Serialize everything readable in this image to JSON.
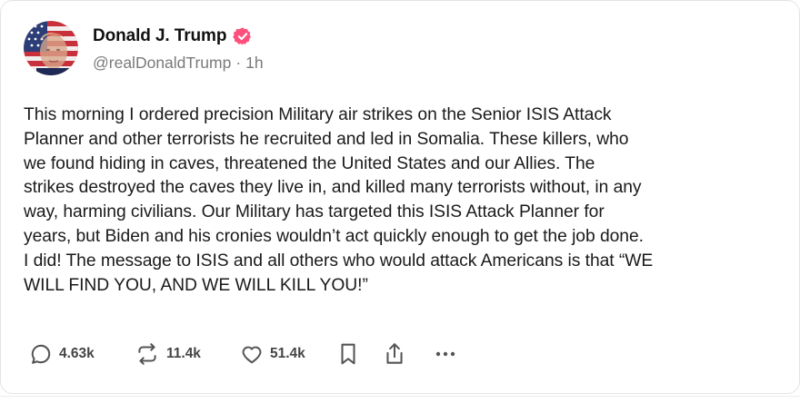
{
  "post": {
    "author": {
      "display_name": "Donald J. Trump",
      "handle": "@realDonaldTrump",
      "verified": true,
      "verified_icon": "verified-badge-icon",
      "avatar_icon": "avatar-flag-portrait"
    },
    "meta_separator": "·",
    "time_ago": "1h",
    "lines": [
      "This morning I ordered precision Military air strikes on the Senior ISIS Attack",
      "Planner and other terrorists he recruited and led in Somalia. These killers, who",
      "we found hiding in caves, threatened the United States and our Allies. The",
      "strikes destroyed the caves they live in, and killed many terrorists without, in any",
      "way, harming civilians. Our Military has targeted this ISIS Attack Planner for",
      "years, but Biden and his cronies wouldn’t act quickly enough to get the job done.",
      "I did! The message to ISIS and all others who would attack Americans is that “WE",
      "WILL FIND YOU, AND WE WILL KILL YOU!”"
    ],
    "actions": {
      "reply": {
        "icon": "reply-bubble-icon",
        "count": "4.63k"
      },
      "retruth": {
        "icon": "repost-arrows-icon",
        "count": "11.4k"
      },
      "like": {
        "icon": "heart-icon",
        "count": "51.4k"
      },
      "bookmark": {
        "icon": "bookmark-icon"
      },
      "share": {
        "icon": "share-upload-icon"
      },
      "more": {
        "icon": "more-dots-icon"
      }
    }
  },
  "colors": {
    "badge": "#ff4f7b",
    "text": "#1a1a1a",
    "muted": "#7a7a7a",
    "icon": "#555555"
  }
}
